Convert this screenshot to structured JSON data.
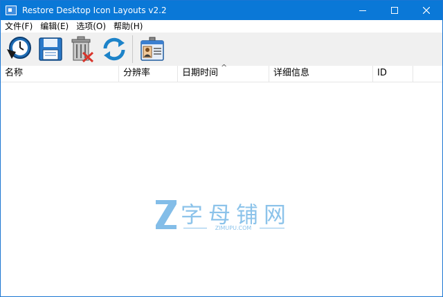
{
  "window": {
    "title": "Restore Desktop Icon Layouts v2.2"
  },
  "menu": {
    "items": [
      {
        "label": "文件(F)"
      },
      {
        "label": "编辑(E)"
      },
      {
        "label": "选项(O)"
      },
      {
        "label": "帮助(H)"
      }
    ]
  },
  "toolbar": {
    "buttons": [
      {
        "icon": "clock-restore-icon"
      },
      {
        "icon": "save-floppy-icon"
      },
      {
        "icon": "trash-delete-icon"
      },
      {
        "icon": "refresh-icon"
      },
      {
        "icon": "id-card-icon"
      }
    ]
  },
  "list": {
    "columns": [
      {
        "label": "名称"
      },
      {
        "label": "分辨率"
      },
      {
        "label": "日期时间"
      },
      {
        "label": "详细信息"
      },
      {
        "label": "ID"
      }
    ],
    "sort_indicator": "^"
  },
  "watermark": {
    "title": "字母铺网",
    "subtitle": "ZIMUPU.COM"
  },
  "colors": {
    "titlebar": "#0a78d7",
    "watermark": "#8cc3ea"
  }
}
